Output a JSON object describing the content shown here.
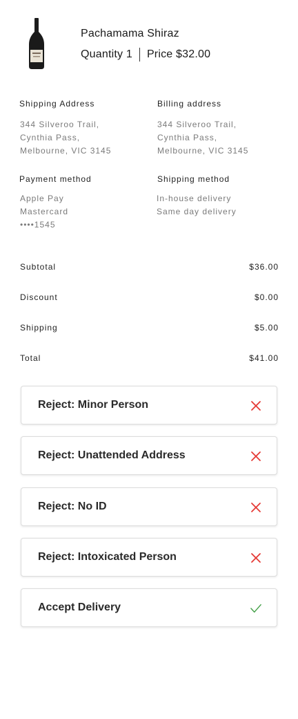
{
  "product": {
    "name": "Pachamama Shiraz",
    "quantity_text": "Quantity 1",
    "price_text": "Price $32.00",
    "image_icon": "wine-bottle-icon"
  },
  "shipping_address": {
    "label": "Shipping Address",
    "lines": [
      "344 Silveroo Trail,",
      "Cynthia Pass,",
      "Melbourne, VIC 3145"
    ]
  },
  "billing_address": {
    "label": "Billing address",
    "lines": [
      "344 Silveroo Trail,",
      "Cynthia Pass,",
      "Melbourne, VIC 3145"
    ]
  },
  "payment_method": {
    "label": "Payment method",
    "lines": [
      "Apple Pay",
      "Mastercard",
      "••••1545"
    ]
  },
  "shipping_method": {
    "label": "Shipping method",
    "lines": [
      "In-house delivery",
      "Same day delivery"
    ]
  },
  "summary": [
    {
      "label": "Subtotal",
      "value": "$36.00"
    },
    {
      "label": "Discount",
      "value": "$0.00"
    },
    {
      "label": "Shipping",
      "value": "$5.00"
    },
    {
      "label": "Total",
      "value": "$41.00"
    }
  ],
  "actions": [
    {
      "label": "Reject: Minor Person",
      "icon": "close-icon",
      "color": "#e53935"
    },
    {
      "label": "Reject: Unattended Address",
      "icon": "close-icon",
      "color": "#e53935"
    },
    {
      "label": "Reject: No ID",
      "icon": "close-icon",
      "color": "#e53935"
    },
    {
      "label": "Reject: Intoxicated Person",
      "icon": "close-icon",
      "color": "#e53935"
    },
    {
      "label": "Accept Delivery",
      "icon": "check-icon",
      "color": "#43a047"
    }
  ]
}
